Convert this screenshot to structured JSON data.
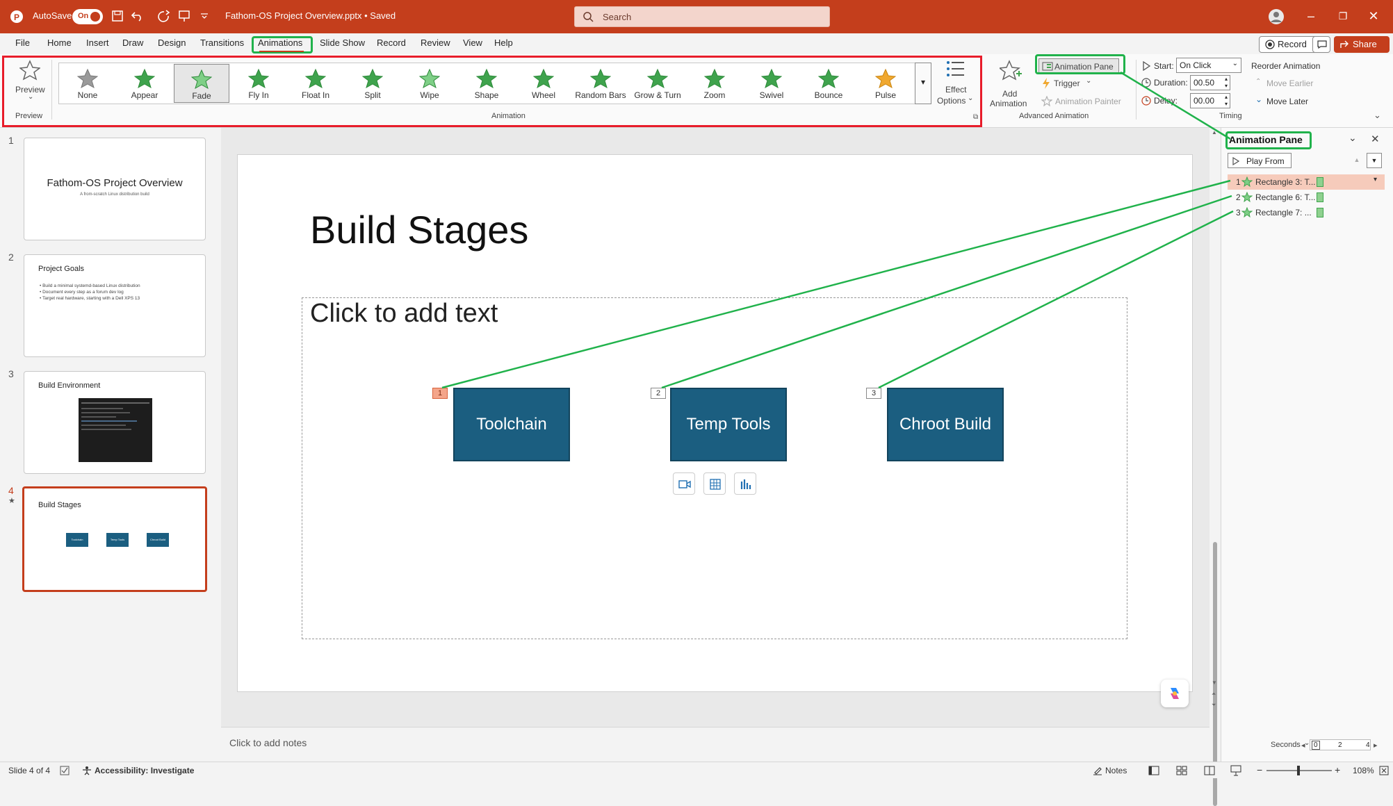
{
  "titlebar": {
    "autosave_label": "AutoSave",
    "autosave_state": "On",
    "doc_title": "Fathom-OS Project Overview.pptx • Saved",
    "search_placeholder": "Search"
  },
  "menu": {
    "tabs": [
      "File",
      "Home",
      "Insert",
      "Draw",
      "Design",
      "Transitions",
      "Animations",
      "Slide Show",
      "Record",
      "Review",
      "View",
      "Help"
    ],
    "active_tab": "Animations",
    "record_label": "Record",
    "share_label": "Share"
  },
  "ribbon": {
    "preview_label": "Preview",
    "preview_group": "Preview",
    "animation_group": "Animation",
    "gallery": [
      {
        "label": "None",
        "icon": "none-star-icon",
        "color": "#9a9a9a"
      },
      {
        "label": "Appear",
        "icon": "appear-star-icon",
        "color": "#3fa34d"
      },
      {
        "label": "Fade",
        "icon": "fade-star-icon",
        "color": "#7fcf87"
      },
      {
        "label": "Fly In",
        "icon": "fly-in-star-icon",
        "color": "#3fa34d"
      },
      {
        "label": "Float In",
        "icon": "float-in-star-icon",
        "color": "#3fa34d"
      },
      {
        "label": "Split",
        "icon": "split-star-icon",
        "color": "#3fa34d"
      },
      {
        "label": "Wipe",
        "icon": "wipe-star-icon",
        "color": "#7fcf87"
      },
      {
        "label": "Shape",
        "icon": "shape-star-icon",
        "color": "#3fa34d"
      },
      {
        "label": "Wheel",
        "icon": "wheel-star-icon",
        "color": "#3fa34d"
      },
      {
        "label": "Random Bars",
        "icon": "random-bars-star-icon",
        "color": "#3fa34d"
      },
      {
        "label": "Grow & Turn",
        "icon": "grow-turn-star-icon",
        "color": "#3fa34d"
      },
      {
        "label": "Zoom",
        "icon": "zoom-star-icon",
        "color": "#3fa34d"
      },
      {
        "label": "Swivel",
        "icon": "swivel-star-icon",
        "color": "#3fa34d"
      },
      {
        "label": "Bounce",
        "icon": "bounce-star-icon",
        "color": "#3fa34d"
      },
      {
        "label": "Pulse",
        "icon": "pulse-star-icon",
        "color": "#f0a830"
      }
    ],
    "selected_effect": "Fade",
    "effect_options_line1": "Effect",
    "effect_options_line2": "Options",
    "add_animation_line1": "Add",
    "add_animation_line2": "Animation",
    "animation_pane_button": "Animation Pane",
    "trigger_label": "Trigger",
    "animation_painter_label": "Animation Painter",
    "advanced_group": "Advanced Animation",
    "start_label": "Start:",
    "start_value": "On Click",
    "duration_label": "Duration:",
    "duration_value": "00.50",
    "delay_label": "Delay:",
    "delay_value": "00.00",
    "reorder_label": "Reorder Animation",
    "move_earlier": "Move Earlier",
    "move_later": "Move Later",
    "timing_group": "Timing"
  },
  "slides": [
    {
      "num": "1",
      "title": "Fathom-OS Project Overview",
      "subtitle": "A from-scratch Linux distribution build"
    },
    {
      "num": "2",
      "title": "Project Goals",
      "bullets": [
        "• Build a minimal systemd-based Linux distribution",
        "• Document every step as a forum dev log",
        "• Target real hardware, starting with a Dell XPS 13"
      ]
    },
    {
      "num": "3",
      "title": "Build Environment"
    },
    {
      "num": "4",
      "title": "Build Stages",
      "boxes": [
        "Toolchain",
        "Temp Tools",
        "Chroot Build"
      ]
    }
  ],
  "current_slide": {
    "title": "Build Stages",
    "placeholder": "Click to add text",
    "boxes": [
      {
        "label": "Toolchain",
        "order": "1"
      },
      {
        "label": "Temp Tools",
        "order": "2"
      },
      {
        "label": "Chroot Build",
        "order": "3"
      }
    ]
  },
  "notes_placeholder": "Click to add notes",
  "animation_pane": {
    "title": "Animation Pane",
    "play_from": "Play From",
    "items": [
      {
        "num": "1",
        "label": "Rectangle 3: T..."
      },
      {
        "num": "2",
        "label": "Rectangle 6: T..."
      },
      {
        "num": "3",
        "label": "Rectangle 7: ..."
      }
    ],
    "seconds_label": "Seconds",
    "timeline_ticks": [
      "0",
      "2",
      "4"
    ]
  },
  "status": {
    "slide_info": "Slide 4 of 4",
    "accessibility": "Accessibility: Investigate",
    "notes_label": "Notes",
    "zoom": "108%"
  },
  "colors": {
    "brand": "#c43e1c",
    "highlight_green": "#20b24b",
    "highlight_red": "#e81c2a",
    "shape_fill": "#1b5e80"
  }
}
